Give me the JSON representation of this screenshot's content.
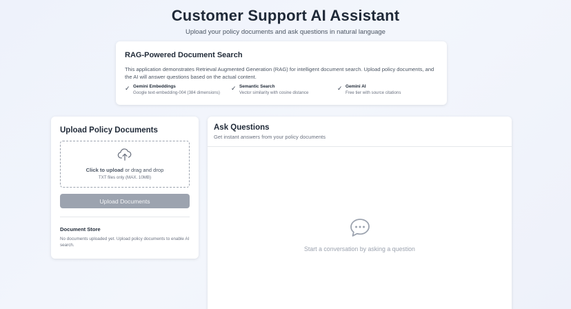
{
  "header": {
    "title": "Customer Support AI Assistant",
    "subtitle": "Upload your policy documents and ask questions in natural language"
  },
  "info": {
    "title": "RAG-Powered Document Search",
    "description": "This application demonstrates Retrieval Augmented Generation (RAG) for intelligent document search. Upload policy documents, and the AI will answer questions based on the actual content.",
    "features": [
      {
        "name": "Gemini Embeddings",
        "desc": "Google text-embedding-004 (384 dimensions)",
        "icon": "check-icon"
      },
      {
        "name": "Semantic Search",
        "desc": "Vector similarity with cosine distance",
        "icon": "check-icon"
      },
      {
        "name": "Gemini AI",
        "desc": "Free tier with source citations",
        "icon": "check-icon"
      }
    ]
  },
  "upload": {
    "title": "Upload Policy Documents",
    "dropzone_action": "Click to upload",
    "dropzone_rest": " or drag and drop",
    "dropzone_hint": "TXT files only (MAX. 10MB)",
    "upload_icon": "cloud-upload-icon",
    "button_label": "Upload Documents",
    "store_title": "Document Store",
    "store_text": "No documents uploaded yet. Upload policy documents to enable AI search."
  },
  "chat": {
    "title": "Ask Questions",
    "subtitle": "Get instant answers from your policy documents",
    "empty_icon": "chat-bubble-icon",
    "empty_text": "Start a conversation by asking a question"
  },
  "colors": {
    "background": "#eef2fb",
    "button_disabled": "#9ca3af",
    "text_primary": "#1f2937",
    "text_muted": "#6b7280"
  }
}
